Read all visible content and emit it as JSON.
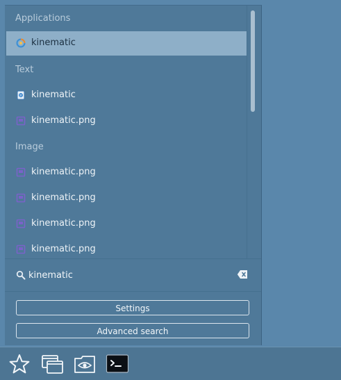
{
  "results": {
    "sections": [
      {
        "title": "Applications",
        "items": [
          {
            "label": "kinematic",
            "icon": "kinematic-app-icon",
            "selected": true
          }
        ]
      },
      {
        "title": "Text",
        "items": [
          {
            "label": "kinematic",
            "icon": "text-file-icon"
          },
          {
            "label": "kinematic.png",
            "icon": "image-file-icon"
          }
        ]
      },
      {
        "title": "Image",
        "items": [
          {
            "label": "kinematic.png",
            "icon": "image-file-icon"
          },
          {
            "label": "kinematic.png",
            "icon": "image-file-icon"
          },
          {
            "label": "kinematic.png",
            "icon": "image-file-icon"
          },
          {
            "label": "kinematic.png",
            "icon": "image-file-icon"
          }
        ]
      }
    ]
  },
  "search": {
    "value": "kinematic",
    "icon": "search-icon",
    "clear_icon": "backspace-clear-icon"
  },
  "buttons": {
    "settings": "Settings",
    "advanced_search": "Advanced search"
  },
  "taskbar": {
    "items": [
      {
        "name": "favorites-star-icon"
      },
      {
        "name": "windows-switcher-icon"
      },
      {
        "name": "file-manager-eye-icon"
      },
      {
        "name": "terminal-icon"
      }
    ]
  },
  "colors": {
    "desktop": "#5a87ab",
    "menu_bg": "#4f7999",
    "selected_bg": "#8eafc8",
    "taskbar_bg": "#4d7593",
    "header_text": "#b9ccdb",
    "item_text": "#eef3f7"
  }
}
